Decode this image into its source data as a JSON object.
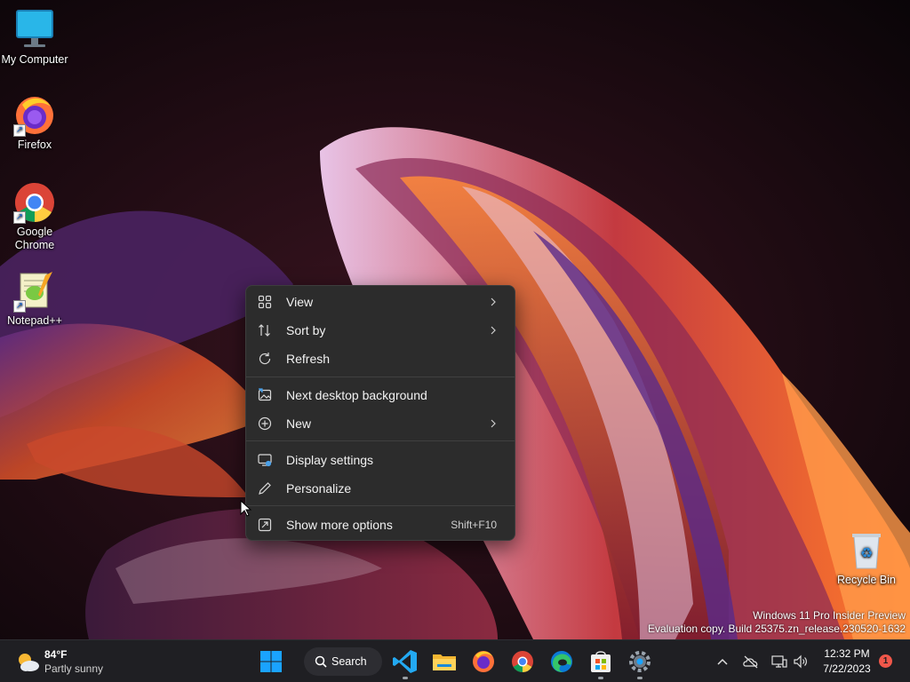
{
  "desktop": {
    "icons": [
      {
        "label": "My Computer",
        "icon": "monitor-icon"
      },
      {
        "label": "Firefox",
        "icon": "firefox-icon"
      },
      {
        "label": "Google\nChrome",
        "icon": "chrome-icon"
      },
      {
        "label": "Notepad++",
        "icon": "notepad-plus-plus-icon"
      },
      {
        "label": "Recycle Bin",
        "icon": "recycle-bin-icon"
      }
    ],
    "watermark": {
      "line1": "Windows 11 Pro Insider Preview",
      "line2": "Evaluation copy. Build 25375.zn_release.230520-1632"
    }
  },
  "context_menu": {
    "items": [
      {
        "label": "View",
        "icon": "grid-view-icon",
        "submenu": true
      },
      {
        "label": "Sort by",
        "icon": "sort-icon",
        "submenu": true
      },
      {
        "label": "Refresh",
        "icon": "refresh-icon",
        "submenu": false
      },
      {
        "label": "Next desktop background",
        "icon": "next-background-icon",
        "submenu": false
      },
      {
        "label": "New",
        "icon": "plus-circle-icon",
        "submenu": true
      },
      {
        "label": "Display settings",
        "icon": "display-settings-icon",
        "submenu": false
      },
      {
        "label": "Personalize",
        "icon": "pen-icon",
        "submenu": false
      },
      {
        "label": "Show more options",
        "icon": "more-options-icon",
        "submenu": false,
        "shortcut": "Shift+F10"
      }
    ]
  },
  "taskbar": {
    "weather": {
      "temp": "84°F",
      "condition": "Partly sunny"
    },
    "search_label": "Search",
    "apps": [
      "start-icon",
      "vscode-icon",
      "file-explorer-icon",
      "firefox-icon",
      "chrome-icon",
      "edge-icon",
      "microsoft-store-icon",
      "settings-icon"
    ],
    "clock": {
      "time": "12:32 PM",
      "date": "7/22/2023"
    },
    "notification_count": "1"
  },
  "colors": {
    "accent": "#0078d4",
    "menu_bg": "#2c2c2c",
    "taskbar_bg": "#1f1f23"
  }
}
